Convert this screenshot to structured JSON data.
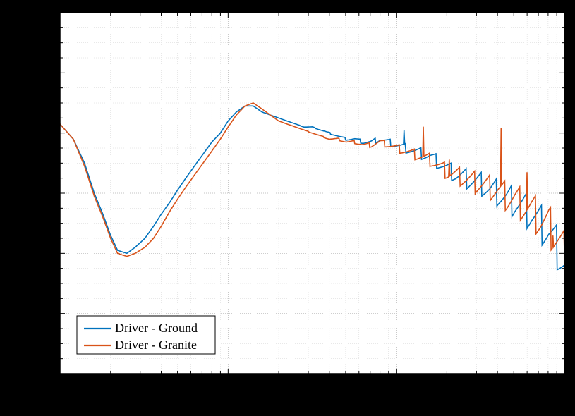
{
  "chart_data": {
    "type": "line",
    "axes": {
      "x": {
        "scale": "log",
        "range": [
          10,
          10000
        ],
        "label": ""
      },
      "y": {
        "scale": "linear",
        "range": [
          -60,
          60
        ],
        "major_step": 20,
        "label": ""
      }
    },
    "grid": true,
    "legend": {
      "position": "bottom-left"
    },
    "series": [
      {
        "name": "Driver - Ground",
        "color": "#0072BD",
        "x": [
          10,
          12,
          14,
          16,
          18,
          20,
          22,
          25,
          28,
          32,
          36,
          40,
          45,
          50,
          56,
          63,
          71,
          80,
          90,
          100,
          112,
          126,
          141,
          159,
          178,
          200,
          224,
          252,
          283,
          317,
          356,
          400,
          449,
          504,
          566,
          635,
          713,
          800,
          898,
          1008,
          1131,
          1270,
          1425,
          1600,
          1796,
          2016,
          2263,
          2540,
          2851,
          3200,
          3592,
          4032,
          4526,
          5080,
          5702,
          6400,
          7184,
          8064,
          9051,
          10000
        ],
        "y": [
          23,
          18,
          10,
          0,
          -7,
          -14,
          -19,
          -20,
          -18,
          -15,
          -11,
          -7,
          -3,
          1,
          5,
          9,
          13,
          17,
          20,
          24,
          27,
          29,
          29,
          27,
          26,
          25,
          24,
          23,
          22,
          22,
          21,
          20,
          19,
          18,
          18,
          17,
          17,
          18,
          17,
          16,
          15,
          14,
          13,
          12,
          10,
          8,
          6,
          5,
          4,
          3,
          1,
          0,
          -2,
          -3,
          -5,
          -7,
          -10,
          -13,
          -18,
          -25
        ]
      },
      {
        "name": "Driver - Granite",
        "color": "#D95319",
        "x": [
          10,
          12,
          14,
          16,
          18,
          20,
          22,
          25,
          28,
          32,
          36,
          40,
          45,
          50,
          56,
          63,
          71,
          80,
          90,
          100,
          112,
          126,
          141,
          159,
          178,
          200,
          224,
          252,
          283,
          317,
          356,
          400,
          449,
          504,
          566,
          635,
          713,
          800,
          898,
          1008,
          1131,
          1270,
          1425,
          1600,
          1796,
          2016,
          2263,
          2540,
          2851,
          3200,
          3592,
          4032,
          4526,
          5080,
          5702,
          6400,
          7184,
          8064,
          9051,
          10000
        ],
        "y": [
          23,
          18,
          9,
          -1,
          -8,
          -15,
          -20,
          -21,
          -20,
          -18,
          -15,
          -11,
          -6,
          -2,
          2,
          6,
          10,
          14,
          18,
          22,
          26,
          29,
          30,
          28,
          26,
          24,
          23,
          22,
          21,
          20,
          19,
          18,
          18,
          17,
          17,
          16,
          16,
          17,
          16,
          15,
          14,
          13,
          12,
          11,
          9,
          7,
          6,
          5,
          4,
          3,
          2,
          1,
          -1,
          -2,
          -4,
          -6,
          -9,
          -11,
          -15,
          -20
        ]
      }
    ]
  },
  "legend_labels": {
    "0": "Driver - Ground",
    "1": "Driver - Granite"
  }
}
